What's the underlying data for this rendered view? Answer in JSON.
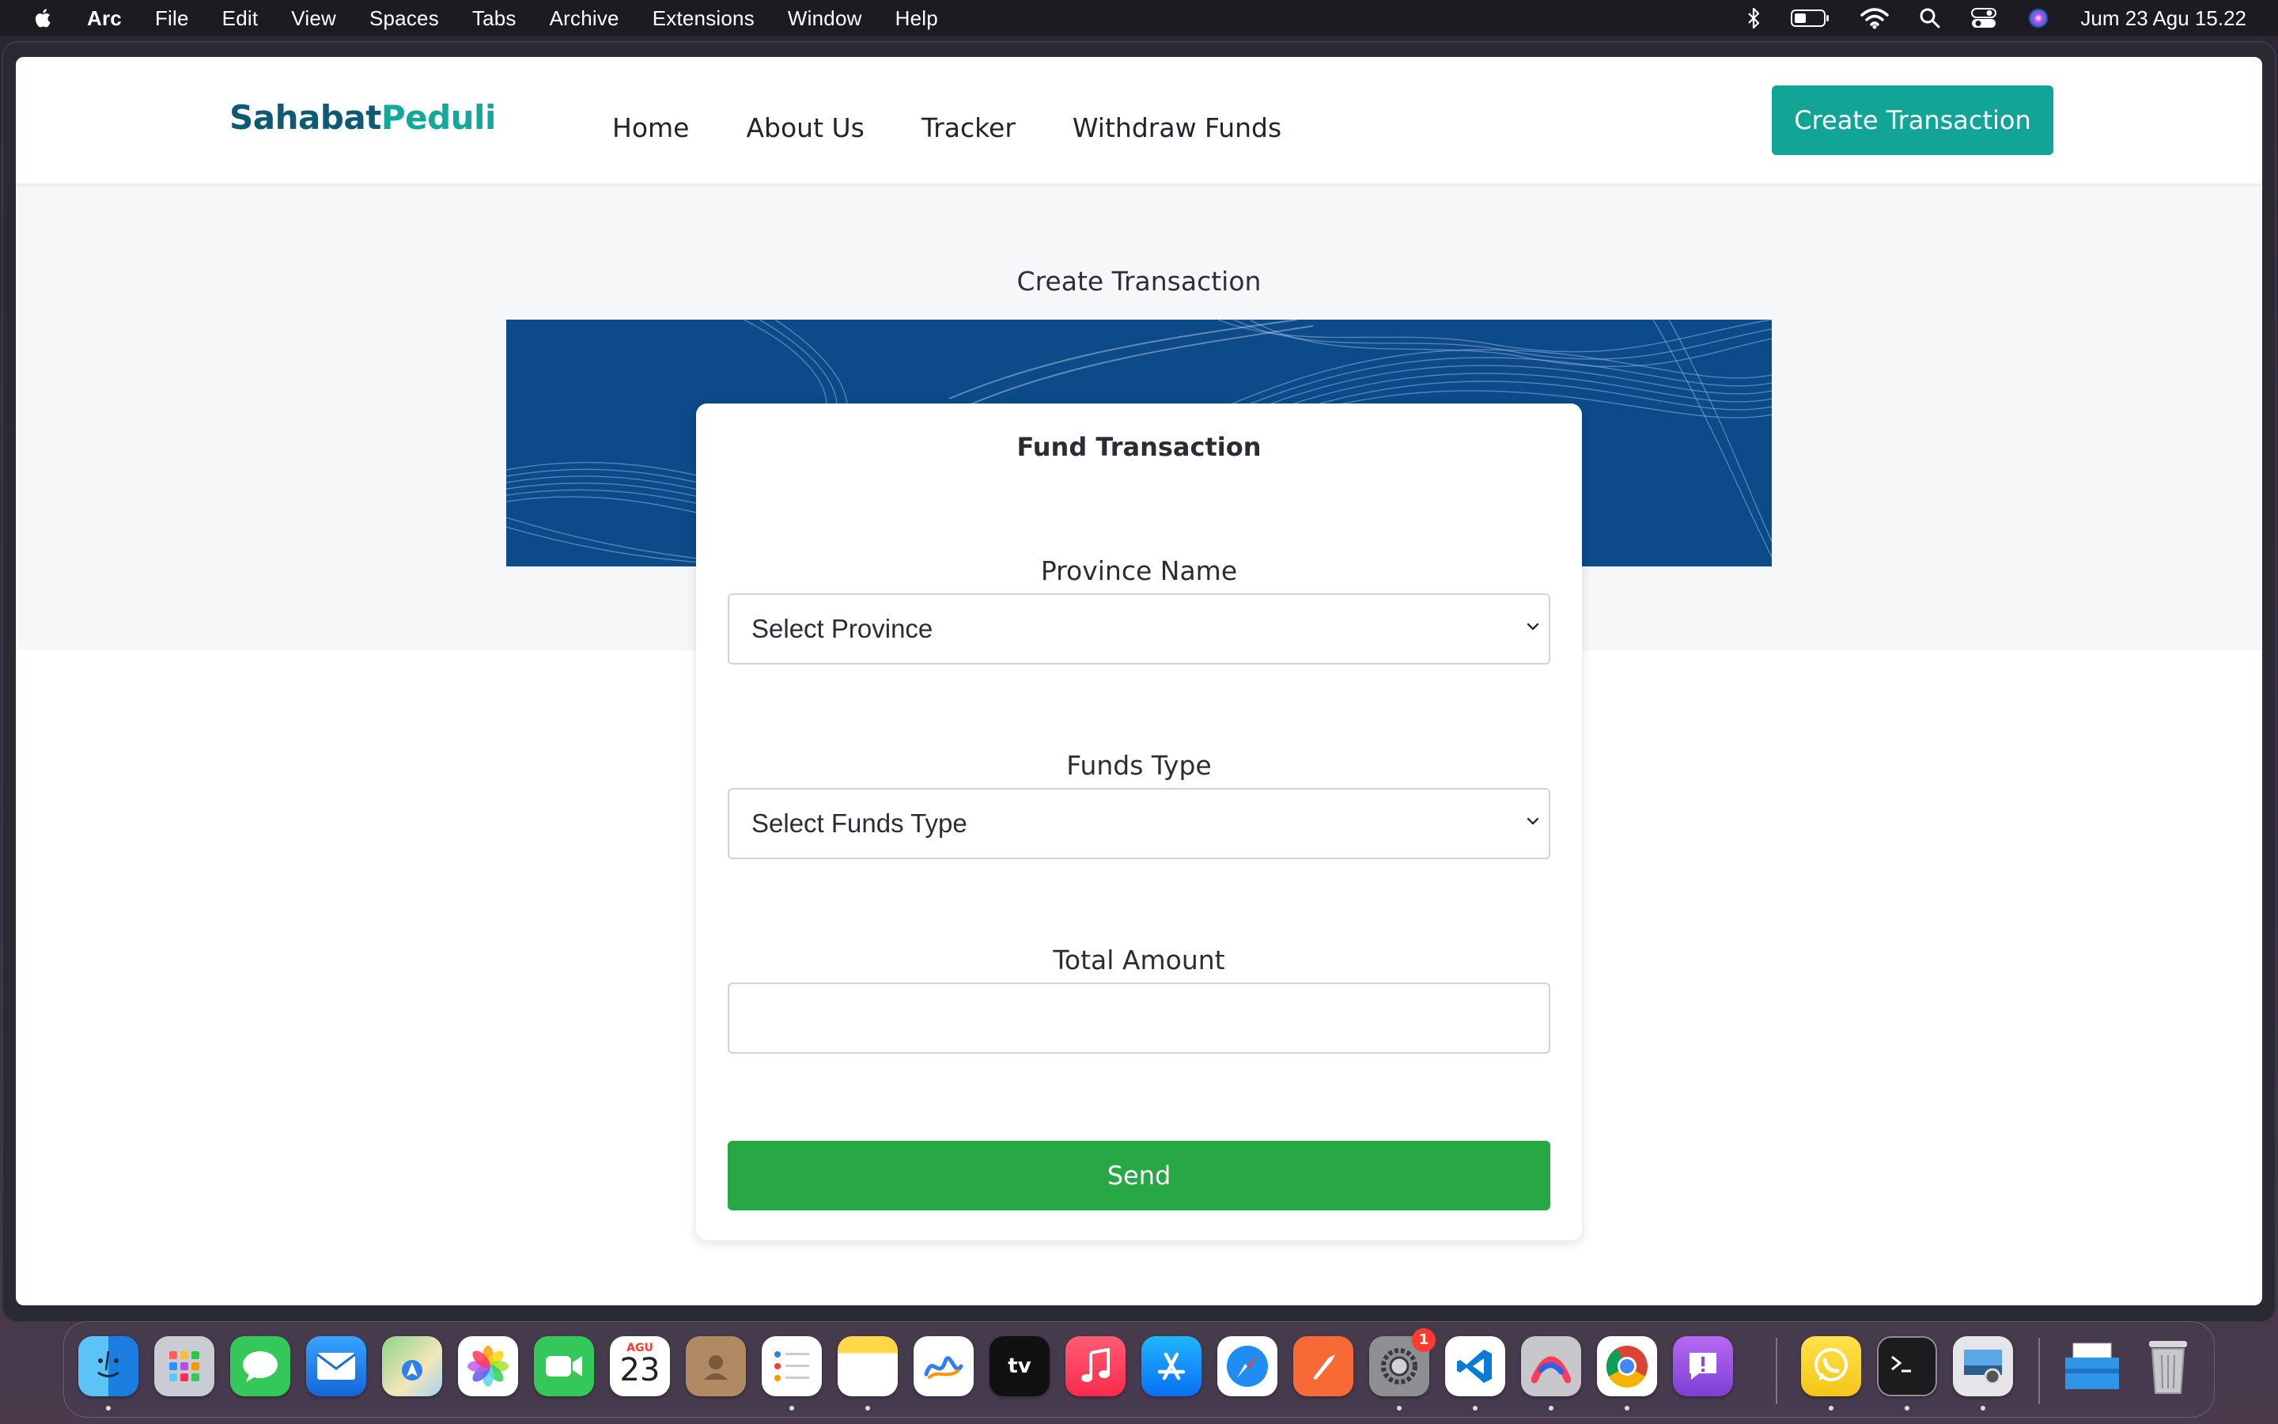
{
  "menubar": {
    "app_name": "Arc",
    "items": [
      "File",
      "Edit",
      "View",
      "Spaces",
      "Tabs",
      "Archive",
      "Extensions",
      "Window",
      "Help"
    ],
    "clock": "Jum 23 Agu  15.22",
    "status_icons": [
      "bluetooth-icon",
      "battery-icon",
      "wifi-icon",
      "search-icon",
      "control-center-icon",
      "siri-icon"
    ]
  },
  "site": {
    "brand_part1": "Sahabat",
    "brand_part2": "Peduli",
    "nav": [
      "Home",
      "About Us",
      "Tracker",
      "Withdraw Funds"
    ],
    "cta_label": "Create Transaction",
    "colors": {
      "brand_dark": "#0e5a75",
      "brand_accent": "#13a89e",
      "send_green": "#28a745",
      "banner_blue": "#0c4a8a"
    }
  },
  "page": {
    "title": "Create Transaction",
    "card_title": "Fund Transaction",
    "province_label": "Province Name",
    "province_value": "Select Province",
    "funds_type_label": "Funds Type",
    "funds_type_value": "Select Funds Type",
    "total_amount_label": "Total Amount",
    "total_amount_value": "",
    "send_label": "Send"
  },
  "dock": {
    "calendar_month": "AGU",
    "calendar_day": "23",
    "tv_label": "tv",
    "settings_badge": "1",
    "apps": [
      "finder-icon",
      "launchpad-icon",
      "messages-icon",
      "mail-icon",
      "maps-icon",
      "photos-icon",
      "facetime-icon",
      "calendar-icon",
      "contacts-icon",
      "reminders-icon",
      "notes-icon",
      "freeform-icon",
      "apple-tv-icon",
      "music-icon",
      "app-store-icon",
      "safari-icon",
      "postman-icon",
      "system-settings-icon",
      "vscode-icon",
      "arc-icon",
      "chrome-icon",
      "feedback-icon",
      "whatsapp-icon",
      "terminal-icon",
      "preview-icon",
      "folder-icon",
      "trash-icon"
    ]
  }
}
